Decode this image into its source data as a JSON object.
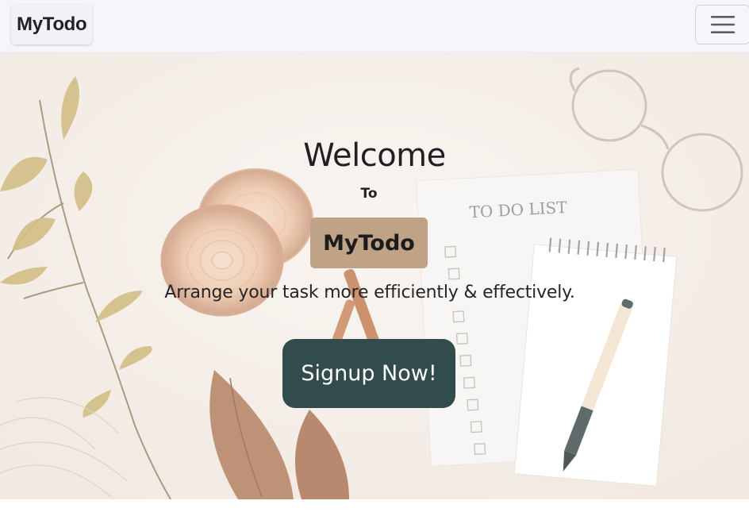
{
  "navbar": {
    "brand": "MyTodo",
    "toggler_icon": "hamburger-menu-icon"
  },
  "hero": {
    "welcome": "Welcome",
    "to": "To",
    "logo": "MyTodo",
    "tagline": "Arrange your task more efficiently & effectively.",
    "cta_label": "Signup Now!",
    "notepad_title": "TO DO LIST"
  },
  "colors": {
    "navbar_bg": "#f6f6fa",
    "logo_badge": "#c0a387",
    "cta_bg": "#324b4d",
    "hero_bg": "#f3ece6"
  }
}
